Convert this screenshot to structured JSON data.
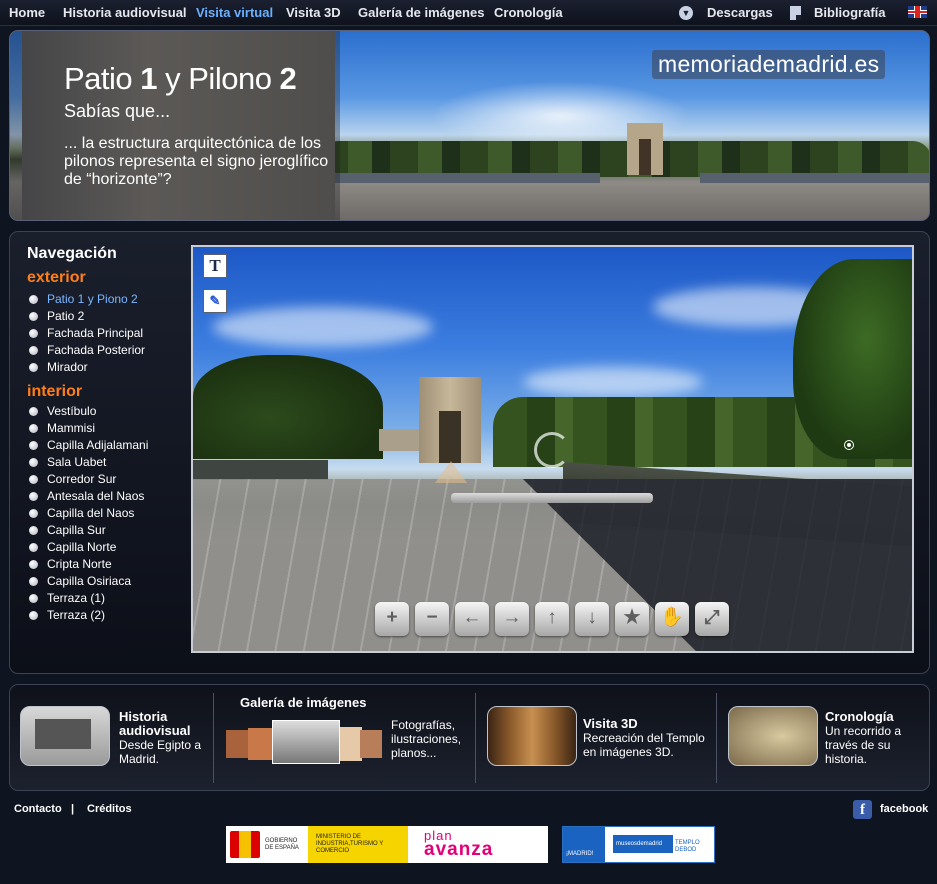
{
  "topnav": {
    "items": [
      "Home",
      "Historia audiovisual",
      "Visita virtual",
      "Visita 3D",
      "Galería de imágenes",
      "Cronología"
    ],
    "active": "Visita virtual",
    "downloads": "Descargas",
    "bibliography": "Bibliografía"
  },
  "banner": {
    "title_a": "Patio ",
    "title_b": "1",
    "title_c": " y Pilono ",
    "title_d": "2",
    "sabias": "Sabías que...",
    "fact": "... la estructura arquitectónica de los pilonos representa el signo jeroglífico de “horizonte”?",
    "brand": "memoriademadrid.es"
  },
  "navigation": {
    "title": "Navegación",
    "exterior_label": "exterior",
    "exterior": [
      "Patio 1 y Piono 2",
      "Patio 2",
      "Fachada Principal",
      "Fachada Posterior",
      "Mirador"
    ],
    "interior_label": "interior",
    "interior": [
      "Vestíbulo",
      "Mammisi",
      "Capilla Adijalamani",
      "Sala Uabet",
      "Corredor Sur",
      "Antesala del Naos",
      "Capilla del Naos",
      "Capilla Sur",
      "Capilla Norte",
      "Cripta Norte",
      "Capilla Osiriaca",
      "Terraza (1)",
      "Terraza (2)"
    ]
  },
  "viewer": {
    "tools": {
      "text": "T",
      "compass": "✎"
    },
    "controls": [
      "+",
      "−",
      "←",
      "→",
      "↑",
      "↓",
      "★",
      "✋",
      "⤢"
    ]
  },
  "features": {
    "historia": {
      "title": "Historia audiovisual",
      "text": "Desde Egipto a Madrid."
    },
    "galeria": {
      "title": "Galería de imágenes",
      "text": "Fotografías, ilustraciones, planos..."
    },
    "visita3d": {
      "title": "Visita 3D",
      "text": "Recreación del Templo en imágenes 3D."
    },
    "cronologia": {
      "title": "Cronología",
      "text": "Un recorrido a través de su historia."
    }
  },
  "footer": {
    "contacto": "Contacto",
    "separator": "|",
    "creditos": "Créditos",
    "facebook": "facebook",
    "logos": {
      "gobierno": "GOBIERNO DE ESPAÑA",
      "ministerio": "MINISTERIO DE INDUSTRIA,TURISMO Y COMERCIO",
      "plan": "plan",
      "avanza": "avanza",
      "madrid": "¡MADRID!",
      "museo": "museosdemadrid",
      "templo": "TEMPLO DEBOD"
    }
  }
}
